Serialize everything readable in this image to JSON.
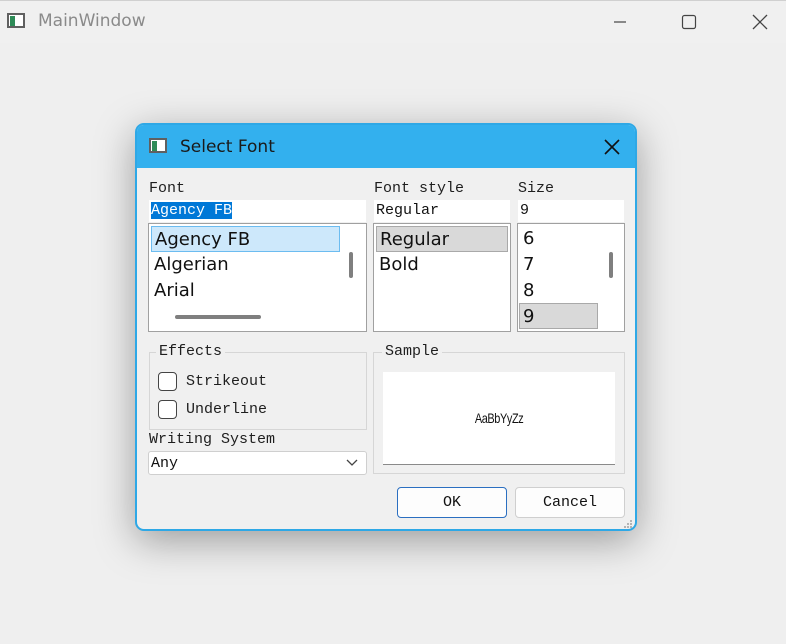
{
  "window": {
    "title": "MainWindow",
    "icons": [
      "app-window-icon",
      "minimize-icon",
      "maximize-icon",
      "close-icon"
    ]
  },
  "dialog": {
    "title": "Select Font",
    "font": {
      "label": "Font",
      "value": "Agency FB",
      "items": [
        "Agency FB",
        "Algerian",
        "Arial"
      ],
      "selected": "Agency FB"
    },
    "font_style": {
      "label": "Font style",
      "value": "Regular",
      "items": [
        "Regular",
        "Bold"
      ],
      "selected": "Regular"
    },
    "size": {
      "label": "Size",
      "value": "9",
      "items": [
        "6",
        "7",
        "8",
        "9"
      ],
      "selected": "9"
    },
    "effects": {
      "title": "Effects",
      "strikeout_label": "Strikeout",
      "strikeout_checked": false,
      "underline_label": "Underline",
      "underline_checked": false
    },
    "writing_system": {
      "label": "Writing System",
      "value": "Any"
    },
    "sample": {
      "title": "Sample",
      "text": "AaBbYyZz"
    },
    "buttons": {
      "ok": "OK",
      "cancel": "Cancel"
    },
    "colors": {
      "titlebar": "#33b0ee",
      "selection": "#0078d7"
    }
  }
}
